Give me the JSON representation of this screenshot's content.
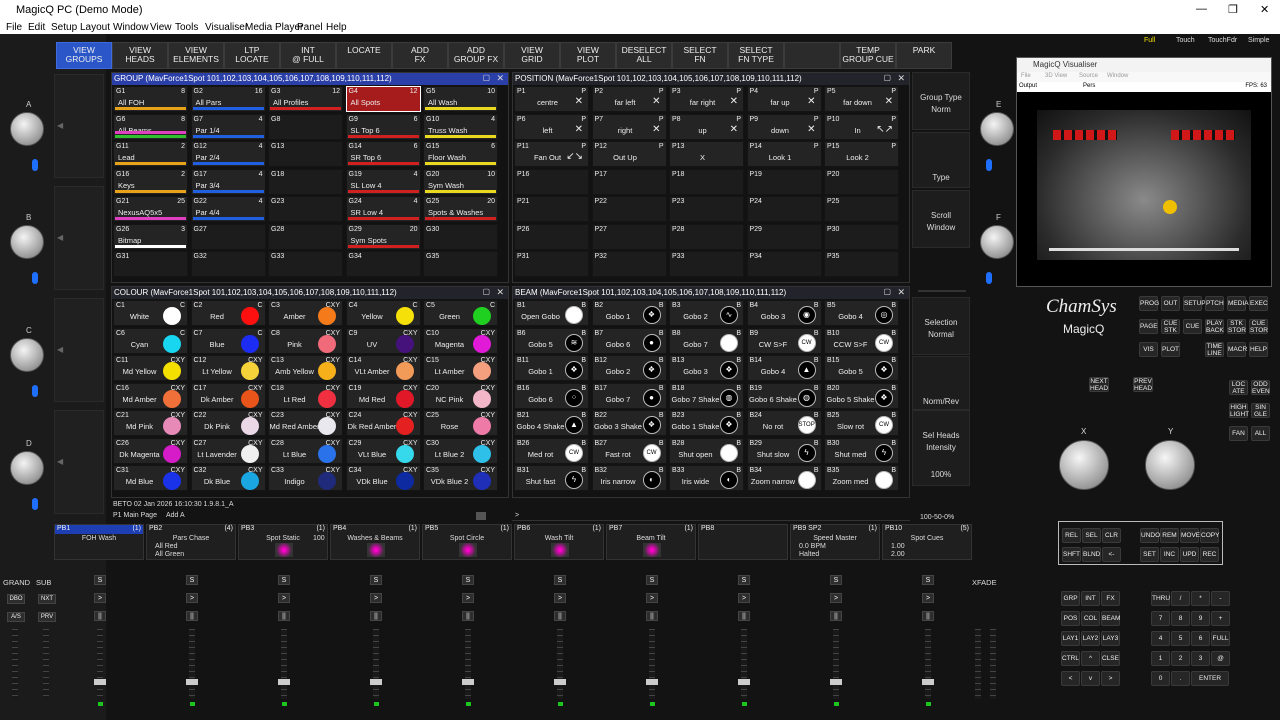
{
  "app": {
    "title": "MagicQ PC (Demo Mode)",
    "win_min": "—",
    "win_max": "❐",
    "win_close": "✕"
  },
  "menu": [
    "File",
    "Edit",
    "Setup",
    "Layout",
    "Window",
    "View",
    "Tools",
    "Visualiser",
    "Media Player",
    "Panel",
    "Help"
  ],
  "top_right_buttons": [
    "Full",
    "Touch",
    "TouchFdr",
    "Simple"
  ],
  "toolbar": [
    {
      "label": "VIEW\nGROUPS",
      "active": true
    },
    {
      "label": "VIEW\nHEADS"
    },
    {
      "label": "VIEW\nELEMENTS"
    },
    {
      "label": "LTP\nLOCATE"
    },
    {
      "label": "INT\n@ FULL"
    },
    {
      "label": "LOCATE"
    },
    {
      "label": "ADD\nFX"
    },
    {
      "label": "ADD\nGROUP FX"
    },
    {
      "label": "VIEW\nGRID"
    },
    {
      "label": "VIEW\nPLOT"
    },
    {
      "label": "DESELECT\nALL"
    },
    {
      "label": "SELECT\nFN"
    },
    {
      "label": "SELECT\nFN TYPE"
    },
    {
      "label": ""
    },
    {
      "label": "TEMP\nGROUP CUE"
    },
    {
      "label": "PARK"
    }
  ],
  "group": {
    "title": "GROUP (MavForce1Spot 101,102,103,104,105,106,107,108,109,110,111,112)",
    "cells": [
      {
        "id": "G1",
        "n": "8",
        "name": "All FOH",
        "bars": [
          "#e8a21a"
        ]
      },
      {
        "id": "G2",
        "n": "16",
        "name": "All Pars",
        "bars": [
          "#2060e0"
        ]
      },
      {
        "id": "G3",
        "n": "12",
        "name": "All Profiles",
        "bars": [
          "#d02020"
        ]
      },
      {
        "id": "G4",
        "n": "12",
        "name": "All Spots",
        "sel": true
      },
      {
        "id": "G5",
        "n": "10",
        "name": "All Wash",
        "bars": [
          "#e8d820"
        ]
      },
      {
        "id": "G6",
        "n": "8",
        "name": "All Beams",
        "bars": [
          "#30c030",
          "#e040c0"
        ]
      },
      {
        "id": "G7",
        "n": "4",
        "name": "Par 1/4",
        "bars": [
          "#2060e0"
        ]
      },
      {
        "id": "G8",
        "n": "",
        "name": "",
        "e": true
      },
      {
        "id": "G9",
        "n": "6",
        "name": "SL Top 6",
        "bars": [
          "#d02020"
        ]
      },
      {
        "id": "G10",
        "n": "4",
        "name": "Truss Wash",
        "bars": [
          "#e8d820"
        ]
      },
      {
        "id": "G11",
        "n": "2",
        "name": "Lead",
        "bars": [
          "#e8a21a"
        ]
      },
      {
        "id": "G12",
        "n": "4",
        "name": "Par 2/4",
        "bars": [
          "#2060e0"
        ]
      },
      {
        "id": "G13",
        "n": "",
        "name": "",
        "e": true
      },
      {
        "id": "G14",
        "n": "6",
        "name": "SR Top 6",
        "bars": [
          "#d02020"
        ]
      },
      {
        "id": "G15",
        "n": "6",
        "name": "Floor Wash",
        "bars": [
          "#e8d820"
        ]
      },
      {
        "id": "G16",
        "n": "2",
        "name": "Keys",
        "bars": [
          "#e8a21a"
        ]
      },
      {
        "id": "G17",
        "n": "4",
        "name": "Par 3/4",
        "bars": [
          "#2060e0"
        ]
      },
      {
        "id": "G18",
        "n": "",
        "name": "",
        "e": true
      },
      {
        "id": "G19",
        "n": "4",
        "name": "SL Low 4",
        "bars": [
          "#d02020"
        ]
      },
      {
        "id": "G20",
        "n": "10",
        "name": "Sym Wash",
        "bars": [
          "#e8d820"
        ]
      },
      {
        "id": "G21",
        "n": "25",
        "name": "NexusAQ5x5",
        "bars": [
          "#e040c0"
        ]
      },
      {
        "id": "G22",
        "n": "4",
        "name": "Par 4/4",
        "bars": [
          "#2060e0"
        ]
      },
      {
        "id": "G23",
        "n": "",
        "name": "",
        "e": true
      },
      {
        "id": "G24",
        "n": "4",
        "name": "SR Low 4",
        "bars": [
          "#d02020"
        ]
      },
      {
        "id": "G25",
        "n": "20",
        "name": "Spots & Washes",
        "bars": [
          "#d02020"
        ]
      },
      {
        "id": "G26",
        "n": "3",
        "name": "Bitmap",
        "bars": [
          "#ffffff"
        ]
      },
      {
        "id": "G27",
        "n": "",
        "name": "",
        "e": true
      },
      {
        "id": "G28",
        "n": "",
        "name": "",
        "e": true
      },
      {
        "id": "G29",
        "n": "20",
        "name": "Sym Spots",
        "bars": [
          "#d02020"
        ]
      },
      {
        "id": "G30",
        "n": "",
        "name": "",
        "e": true
      },
      {
        "id": "G31",
        "n": "",
        "name": "",
        "e": true
      },
      {
        "id": "G32",
        "n": "",
        "name": "",
        "e": true
      },
      {
        "id": "G33",
        "n": "",
        "name": "",
        "e": true
      },
      {
        "id": "G34",
        "n": "",
        "name": "",
        "e": true
      },
      {
        "id": "G35",
        "n": "",
        "name": "",
        "e": true
      }
    ]
  },
  "position": {
    "title": "POSITION (MavForce1Spot 101,102,103,104,105,106,107,108,109,110,111,112)",
    "cells": [
      {
        "id": "P1",
        "n": "P",
        "name": "centre",
        "ic": "✕"
      },
      {
        "id": "P2",
        "n": "P",
        "name": "far left",
        "ic": "✕"
      },
      {
        "id": "P3",
        "n": "P",
        "name": "far right",
        "ic": "✕"
      },
      {
        "id": "P4",
        "n": "P",
        "name": "far up",
        "ic": "✕"
      },
      {
        "id": "P5",
        "n": "P",
        "name": "far down",
        "ic": "✕"
      },
      {
        "id": "P6",
        "n": "P",
        "name": "left",
        "ic": "✕"
      },
      {
        "id": "P7",
        "n": "P",
        "name": "right",
        "ic": "✕"
      },
      {
        "id": "P8",
        "n": "P",
        "name": "up",
        "ic": "✕"
      },
      {
        "id": "P9",
        "n": "P",
        "name": "down",
        "ic": "✕"
      },
      {
        "id": "P10",
        "n": "P",
        "name": "In",
        "ic": "↖↗"
      },
      {
        "id": "P11",
        "n": "P",
        "name": "Fan Out",
        "ic": "↙↘"
      },
      {
        "id": "P12",
        "n": "P",
        "name": "Out Up",
        "ic": ""
      },
      {
        "id": "P13",
        "n": "",
        "name": "X",
        "ic": ""
      },
      {
        "id": "P14",
        "n": "P",
        "name": "Look 1",
        "ic": ""
      },
      {
        "id": "P15",
        "n": "P",
        "name": "Look 2",
        "ic": ""
      },
      {
        "id": "P16",
        "e": true
      },
      {
        "id": "P17",
        "e": true
      },
      {
        "id": "P18",
        "e": true
      },
      {
        "id": "P19",
        "e": true
      },
      {
        "id": "P20",
        "e": true
      },
      {
        "id": "P21",
        "e": true
      },
      {
        "id": "P22",
        "e": true
      },
      {
        "id": "P23",
        "e": true
      },
      {
        "id": "P24",
        "e": true
      },
      {
        "id": "P25",
        "e": true
      },
      {
        "id": "P26",
        "e": true
      },
      {
        "id": "P27",
        "e": true
      },
      {
        "id": "P28",
        "e": true
      },
      {
        "id": "P29",
        "e": true
      },
      {
        "id": "P30",
        "e": true
      },
      {
        "id": "P31",
        "e": true
      },
      {
        "id": "P32",
        "e": true
      },
      {
        "id": "P33",
        "e": true
      },
      {
        "id": "P34",
        "e": true
      },
      {
        "id": "P35",
        "e": true
      }
    ]
  },
  "colour": {
    "title": "COLOUR (MavForce1Spot 101,102,103,104,105,106,107,108,109,110,111,112)",
    "cells": [
      {
        "id": "C1",
        "n": "C",
        "name": "White",
        "c": "#ffffff"
      },
      {
        "id": "C2",
        "n": "C",
        "name": "Red",
        "c": "#ff1010"
      },
      {
        "id": "C3",
        "n": "CXY",
        "name": "Amber",
        "c": "#f57a1a"
      },
      {
        "id": "C4",
        "n": "C",
        "name": "Yellow",
        "c": "#f5e00a"
      },
      {
        "id": "C5",
        "n": "C",
        "name": "Green",
        "c": "#20d020"
      },
      {
        "id": "C6",
        "n": "C",
        "name": "Cyan",
        "c": "#19d6f0"
      },
      {
        "id": "C7",
        "n": "C",
        "name": "Blue",
        "c": "#1c2cf2"
      },
      {
        "id": "C8",
        "n": "CXY",
        "name": "Pink",
        "c": "#f06a7a"
      },
      {
        "id": "C9",
        "n": "CXY",
        "name": "UV",
        "c": "#44127a"
      },
      {
        "id": "C10",
        "n": "CXY",
        "name": "Magenta",
        "c": "#e01ad6"
      },
      {
        "id": "C11",
        "n": "CXY",
        "name": "Md Yellow",
        "c": "#f3e000"
      },
      {
        "id": "C12",
        "n": "CXY",
        "name": "Lt Yellow",
        "c": "#f6d23a"
      },
      {
        "id": "C13",
        "n": "CXY",
        "name": "Amb Yellow",
        "c": "#f5b01a"
      },
      {
        "id": "C14",
        "n": "CXY",
        "name": "VLt Amber",
        "c": "#f29a58"
      },
      {
        "id": "C15",
        "n": "CXY",
        "name": "Lt Amber",
        "c": "#f4a07e"
      },
      {
        "id": "C16",
        "n": "CXY",
        "name": "Md Amber",
        "c": "#f0703a"
      },
      {
        "id": "C17",
        "n": "CXY",
        "name": "Dk Amber",
        "c": "#e8541a"
      },
      {
        "id": "C18",
        "n": "CXY",
        "name": "Lt Red",
        "c": "#f03040"
      },
      {
        "id": "C19",
        "n": "CXY",
        "name": "Md Red",
        "c": "#e01828"
      },
      {
        "id": "C20",
        "n": "CXY",
        "name": "NC Pink",
        "c": "#f2b6c8"
      },
      {
        "id": "C21",
        "n": "CXY",
        "name": "Md Pink",
        "c": "#e88ab8"
      },
      {
        "id": "C22",
        "n": "CXY",
        "name": "Dk Pink",
        "c": "#ebd8e6"
      },
      {
        "id": "C23",
        "n": "CXY",
        "name": "Md Red Amber",
        "c": "#e8e8ee"
      },
      {
        "id": "C24",
        "n": "CXY",
        "name": "Dk Red Amber",
        "c": "#e42020"
      },
      {
        "id": "C25",
        "n": "CXY",
        "name": "Rose",
        "c": "#ee7aa8"
      },
      {
        "id": "C26",
        "n": "CXY",
        "name": "Dk Magenta",
        "c": "#d61cc8"
      },
      {
        "id": "C27",
        "n": "CXY",
        "name": "Lt Lavender",
        "c": "#f0f0f0"
      },
      {
        "id": "C28",
        "n": "CXY",
        "name": "Lt Blue",
        "c": "#2a72ea"
      },
      {
        "id": "C29",
        "n": "CXY",
        "name": "VLt Blue",
        "c": "#36d8ec"
      },
      {
        "id": "C30",
        "n": "CXY",
        "name": "Lt Blue 2",
        "c": "#2ec0e8"
      },
      {
        "id": "C31",
        "n": "CXY",
        "name": "Md Blue",
        "c": "#1a32e8"
      },
      {
        "id": "C32",
        "n": "CXY",
        "name": "Dk Blue",
        "c": "#1aa6e0"
      },
      {
        "id": "C33",
        "n": "CXY",
        "name": "Indigo",
        "c": "#1f2b7a"
      },
      {
        "id": "C34",
        "n": "CXY",
        "name": "VDk Blue",
        "c": "#0e2aa0"
      },
      {
        "id": "C35",
        "n": "CXY",
        "name": "VDk Blue 2",
        "c": "#1f2fb8"
      }
    ]
  },
  "beam": {
    "title": "BEAM (MavForce1Spot 101,102,103,104,105,106,107,108,109,110,111,112)",
    "cells": [
      {
        "id": "B1",
        "n": "B",
        "name": "Open Gobo",
        "g": "w"
      },
      {
        "id": "B2",
        "n": "B",
        "name": "Gobo 1",
        "g": "❖"
      },
      {
        "id": "B3",
        "n": "B",
        "name": "Gobo 2",
        "g": "∿"
      },
      {
        "id": "B4",
        "n": "B",
        "name": "Gobo 3",
        "g": "◉"
      },
      {
        "id": "B5",
        "n": "B",
        "name": "Gobo 4",
        "g": "◎"
      },
      {
        "id": "B6",
        "n": "B",
        "name": "Gobo 5",
        "g": "≋"
      },
      {
        "id": "B7",
        "n": "B",
        "name": "Gobo 6",
        "g": "●"
      },
      {
        "id": "B8",
        "n": "B",
        "name": "Gobo 7",
        "g": "w"
      },
      {
        "id": "B9",
        "n": "B",
        "name": "CW S>F",
        "g": "CW"
      },
      {
        "id": "B10",
        "n": "B",
        "name": "CCW S>F",
        "g": "CW"
      },
      {
        "id": "B11",
        "n": "B",
        "name": "Gobo 1",
        "g": "❖"
      },
      {
        "id": "B12",
        "n": "B",
        "name": "Gobo 2",
        "g": "❖"
      },
      {
        "id": "B13",
        "n": "B",
        "name": "Gobo 3",
        "g": "❖"
      },
      {
        "id": "B14",
        "n": "B",
        "name": "Gobo 4",
        "g": "▲"
      },
      {
        "id": "B15",
        "n": "B",
        "name": "Gobo 5",
        "g": "❖"
      },
      {
        "id": "B16",
        "n": "B",
        "name": "Gobo 6",
        "g": "⁘"
      },
      {
        "id": "B17",
        "n": "B",
        "name": "Gobo 7",
        "g": "●"
      },
      {
        "id": "B18",
        "n": "B",
        "name": "Gobo 7 Shake",
        "g": "◍"
      },
      {
        "id": "B19",
        "n": "B",
        "name": "Gobo 6 Shake",
        "g": "◍"
      },
      {
        "id": "B20",
        "n": "B",
        "name": "Gobo 5 Shake",
        "g": "❖"
      },
      {
        "id": "B21",
        "n": "B",
        "name": "Gobo 4 Shake",
        "g": "▲"
      },
      {
        "id": "B22",
        "n": "B",
        "name": "Gobo 3 Shake",
        "g": "❖"
      },
      {
        "id": "B23",
        "n": "B",
        "name": "Gobo 1 Shake",
        "g": "❖"
      },
      {
        "id": "B24",
        "n": "B",
        "name": "No rot",
        "g": "STOP"
      },
      {
        "id": "B25",
        "n": "B",
        "name": "Slow rot",
        "g": "CW"
      },
      {
        "id": "B26",
        "n": "B",
        "name": "Med rot",
        "g": "CW"
      },
      {
        "id": "B27",
        "n": "B",
        "name": "Fast rot",
        "g": "CW"
      },
      {
        "id": "B28",
        "n": "B",
        "name": "Shut open",
        "g": "w"
      },
      {
        "id": "B29",
        "n": "B",
        "name": "Shut slow",
        "g": "ϟ"
      },
      {
        "id": "B30",
        "n": "B",
        "name": "Shut med",
        "g": "ϟ"
      },
      {
        "id": "B31",
        "n": "B",
        "name": "Shut fast",
        "g": "ϟ"
      },
      {
        "id": "B32",
        "n": "B",
        "name": "Iris narrow",
        "g": "◐"
      },
      {
        "id": "B33",
        "n": "B",
        "name": "Iris wide",
        "g": "◐"
      },
      {
        "id": "B34",
        "n": "B",
        "name": "Zoom narrow",
        "g": "w"
      },
      {
        "id": "B35",
        "n": "B",
        "name": "Zoom med",
        "g": "w"
      }
    ]
  },
  "right_panel": {
    "group_type": "Group Type",
    "norm": "Norm",
    "type": "Type",
    "scroll": "Scroll",
    "window": "Window",
    "selection": "Selection",
    "normal": "Normal",
    "norm_rev": "Norm/Rev",
    "sel_heads": "Sel Heads",
    "intensity": "Intensity",
    "pct": "100%",
    "range": "100-50-0%"
  },
  "status": {
    "line1": "BETO 02 Jan 2026 16:10:30 1.9.8.1_A",
    "line2": "P1 Main Page",
    "add": "Add A",
    "cmd": ">"
  },
  "playbacks": [
    {
      "id": "PB1",
      "n": "(1)",
      "name": "FOH Wash",
      "act": true
    },
    {
      "id": "PB2",
      "n": "(4)",
      "name": "Pars Chase",
      "l1": "All Red",
      "l2": "All Green"
    },
    {
      "id": "PB3",
      "n": "(1)",
      "name": "Spot Static",
      "v": "100"
    },
    {
      "id": "PB4",
      "n": "(1)",
      "name": "Washes & Beams"
    },
    {
      "id": "PB5",
      "n": "(1)",
      "name": "Spot Circle"
    },
    {
      "id": "PB6",
      "n": "(1)",
      "name": "Wash Tilt"
    },
    {
      "id": "PB7",
      "n": "(1)",
      "name": "Beam Tilt"
    },
    {
      "id": "PB8",
      "n": "",
      "name": ""
    },
    {
      "id": "PB9 SP2",
      "n": "(1)",
      "name": "Speed Master",
      "l1": "0.0 BPM",
      "l2": "Halted"
    },
    {
      "id": "PB10",
      "n": "(5)",
      "name": "Spot Cues",
      "l1": "1.00",
      "l2": "2.00"
    }
  ],
  "fader_labels": {
    "grand": "GRAND",
    "sub": "SUB",
    "dbo": "DBO",
    "nxt": "NXT",
    "as": "A/S",
    "prv": "PRV",
    "xfade": "XFADE"
  },
  "encoders": [
    "A",
    "B",
    "C",
    "D",
    "E",
    "F"
  ],
  "visualiser": {
    "title": "MagicQ Visualiser",
    "menu": [
      "File",
      "3D View",
      "Source",
      "Window"
    ],
    "output": "Output",
    "pers": "Pers",
    "fps": "FPS: 63"
  },
  "brand": {
    "name": "ChamSys",
    "product": "MagicQ"
  },
  "panel_buttons": [
    [
      "PROG",
      "OUT",
      "SETUP",
      "PTCH",
      "MEDIA",
      "EXEC"
    ],
    [
      "PAGE",
      "CUE\nSTK",
      "CUE",
      "PLAY\nBACK",
      "STK\nSTOR",
      "CUE\nSTOR"
    ],
    [
      "VIS",
      "PLOT",
      "",
      "TIME\nLINE",
      "MACR",
      "HELP"
    ]
  ],
  "head_buttons": [
    "NEXT\nHEAD",
    "PREV\nHEAD"
  ],
  "side_buttons": [
    "LOC\nATE",
    "ODD\nEVEN",
    "HIGH\nLIGHT",
    "SIN\nGLE",
    "FAN",
    "ALL"
  ],
  "xy": {
    "x": "X",
    "y": "Y"
  },
  "cmd_keys": [
    [
      "REL",
      "SEL",
      "CLR"
    ],
    [
      "SHFT",
      "BLND",
      "<-"
    ],
    [
      "UNDO",
      "REM",
      "MOVE",
      "COPY"
    ],
    [
      "SET",
      "INC",
      "UPD",
      "REC"
    ]
  ],
  "keypad": [
    [
      "GRP",
      "INT",
      "FX",
      "",
      "THRU",
      "/",
      "*",
      "-"
    ],
    [
      "POS",
      "COL",
      "BEAM",
      "",
      "7",
      "8",
      "9",
      "+"
    ],
    [
      "LAY1",
      "LAY2",
      "LAY3",
      "",
      "4",
      "5",
      "6",
      "FULL"
    ],
    [
      "CTRL",
      "^",
      "CLSE",
      "",
      "1",
      "2",
      "3",
      "@"
    ],
    [
      "<",
      "v",
      ">",
      "",
      "0",
      ".",
      "ENTER",
      ""
    ]
  ]
}
